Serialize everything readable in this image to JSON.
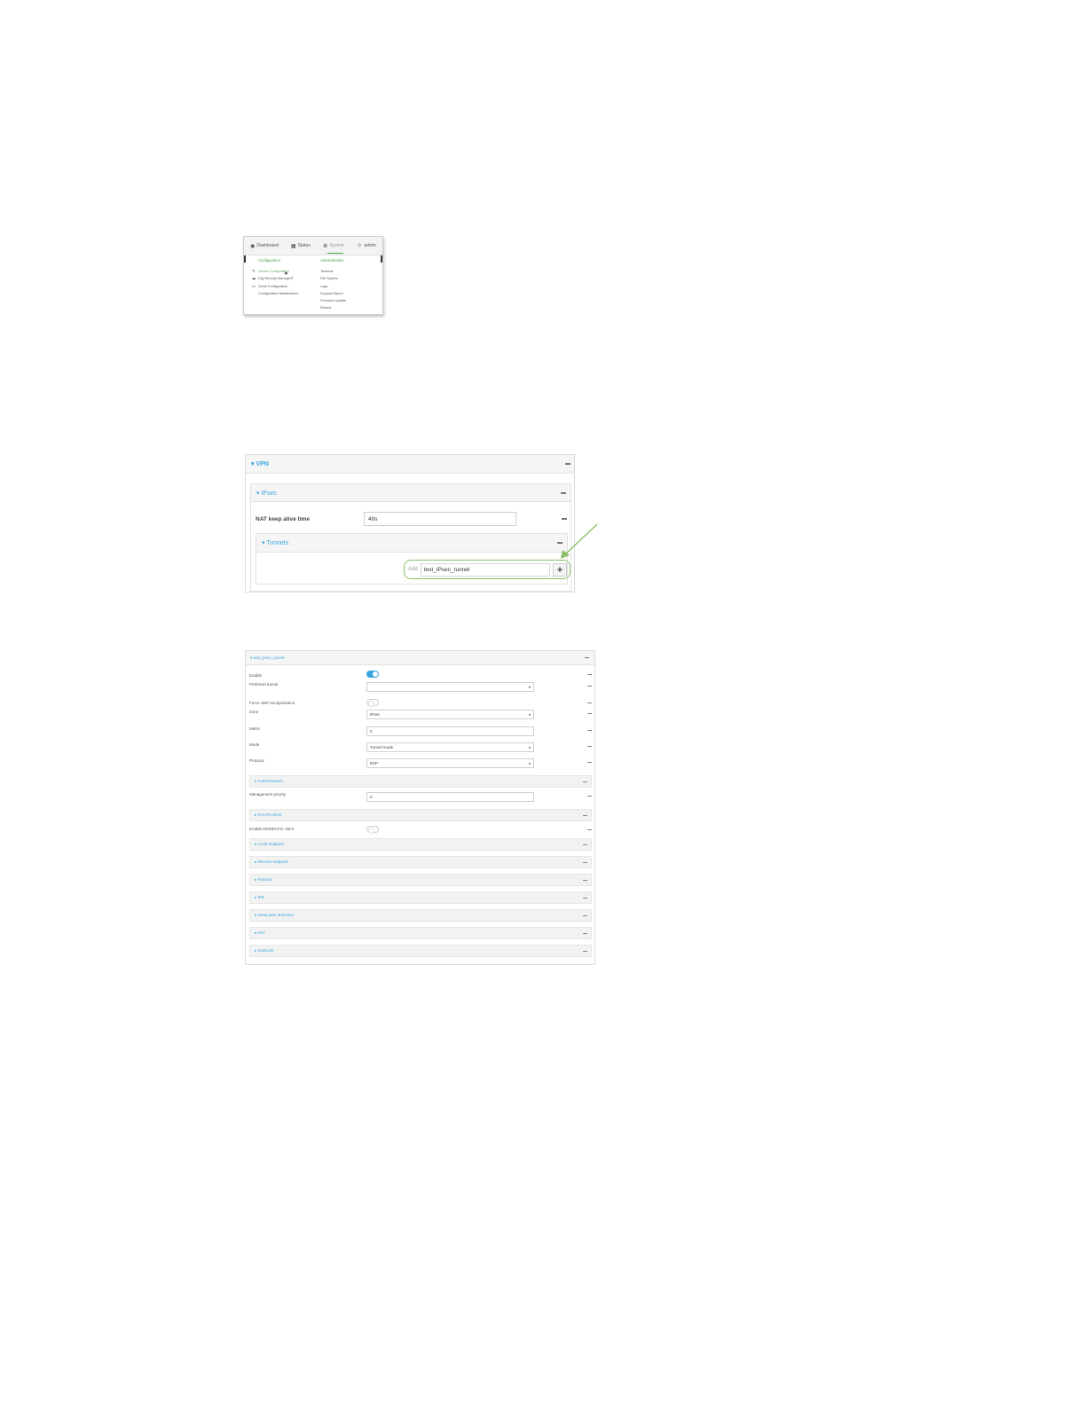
{
  "system_menu": {
    "topbar": [
      {
        "label": "Dashboard",
        "icon": "dashboard-icon"
      },
      {
        "label": "Status",
        "icon": "grid-icon"
      },
      {
        "label": "System",
        "icon": "gear-icon"
      },
      {
        "label": "admin",
        "icon": "user-icon"
      }
    ],
    "configuration": {
      "heading": "Configuration",
      "items": [
        "Device Configuration",
        "Digi Remote Manager®",
        "Serial Configuration",
        "Configuration Maintenance"
      ]
    },
    "administration": {
      "heading": "Administration",
      "items": [
        "Terminal",
        "File System",
        "Logs",
        "Support Report",
        "Firmware Update",
        "Reboot"
      ]
    },
    "accent_color": "#4aa84a"
  },
  "vpn_panel": {
    "vpn_title": "VPN",
    "ipsec_title": "IPsec",
    "nat_label": "NAT keep alive time",
    "nat_value": "40s",
    "tunnels_title": "Tunnels",
    "add_label": "Add",
    "add_value": "test_IPsec_tunnel",
    "add_button": "+",
    "highlight_color": "#8cc06a"
  },
  "tunnel_panel": {
    "title": "test_ipsec_tunnel",
    "fields": [
      {
        "label": "Enable",
        "type": "toggle",
        "on": true
      },
      {
        "label": "Preferred tunnel",
        "type": "select",
        "value": ""
      },
      {
        "label": "Force UDP encapsulation",
        "type": "toggle",
        "on": false
      },
      {
        "label": "Zone",
        "type": "select",
        "value": "IPsec"
      },
      {
        "label": "Metric",
        "type": "input",
        "value": "0"
      },
      {
        "label": "Mode",
        "type": "select",
        "value": "Tunnel mode"
      },
      {
        "label": "Protocol",
        "type": "select",
        "value": "ESP"
      }
    ],
    "authentication": "Authentication",
    "management_priority_label": "Management priority",
    "management_priority_value": "0",
    "xauth": "XAUTH client",
    "modecfg_label": "Enable MODECFG client",
    "sections": [
      "Local endpoint",
      "Remote endpoint",
      "Policies",
      "IKE",
      "Dead peer detection",
      "NAT",
      "SureLink"
    ],
    "link_color": "#3aa6dd"
  }
}
